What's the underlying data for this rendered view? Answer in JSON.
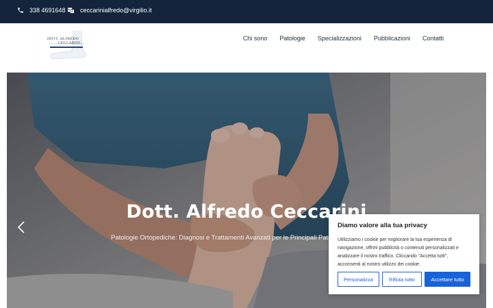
{
  "topbar": {
    "phone": "338 4691648",
    "phone_icon": "phone-icon",
    "email": "ceccarinialfredo@virgilio.it",
    "email_icon": "envelope-icon"
  },
  "logo": {
    "line1": "DOTT. ALFREDO",
    "line2": "CECCARINI"
  },
  "nav": {
    "items": [
      {
        "label": "Chi sono"
      },
      {
        "label": "Patologie"
      },
      {
        "label": "Specializzazioni"
      },
      {
        "label": "Pubblicazioni"
      },
      {
        "label": "Contatti"
      }
    ]
  },
  "hero": {
    "title": "Dott. Alfredo Ceccarini",
    "subtitle": "Patologie Ortopediche: Diagnosi e Trattamenti Avanzati per le Principali Patologie",
    "prev_icon": "chevron-left-icon"
  },
  "cookie": {
    "title": "Diamo valore alla tua privacy",
    "text": "Utilizziamo i cookie per migliorare la tua esperienza di navigazione, offrirti pubblicità o contenuti personalizzati e analizzare il nostro traffico. Cliccando \"Accetta tutti\", acconsenti al nostro utilizzo dei cookie.",
    "customize_label": "Personalizza",
    "reject_label": "Rifiuta tutto",
    "accept_label": "Accettare tutto"
  },
  "colors": {
    "topbar_bg": "#13243c",
    "accent": "#1863dc",
    "nav_text": "#1c2a3c"
  }
}
